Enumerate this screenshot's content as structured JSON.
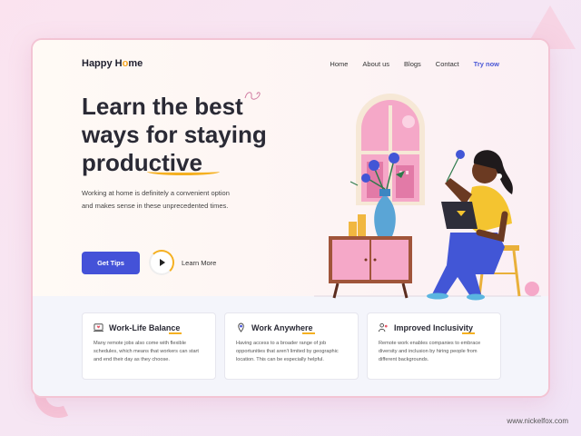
{
  "brand": {
    "logo_left": "Happy H",
    "logo_o": "o",
    "logo_right": "me"
  },
  "nav": {
    "home": "Home",
    "about": "About us",
    "blogs": "Blogs",
    "contact": "Contact",
    "try": "Try now"
  },
  "hero": {
    "line1": "Learn the best",
    "line2": "ways for staying",
    "line3": "productive",
    "description": "Working at home is definitely a convenient option and makes sense in these unprecedented times.",
    "cta_primary": "Get Tips",
    "cta_secondary": "Learn More"
  },
  "features": [
    {
      "title": "Work-Life Balance",
      "text": "Many remote jobs also come with flexible schedules, which means that workers can start and end their day as they choose.",
      "icon": "laptop-heart-icon"
    },
    {
      "title": "Work Anywhere",
      "text": "Having access to a broader range of job opportunities that aren't limited by geographic location. This can be especially helpful.",
      "icon": "location-pin-icon"
    },
    {
      "title": "Improved Inclusivity",
      "text": "Remote work enables companies to embrace diversity and inclusion by hiring people from different backgrounds.",
      "icon": "people-icon"
    }
  ],
  "footer": {
    "website": "www.nickelfox.com"
  },
  "colors": {
    "accent": "#4452d8",
    "highlight": "#f5b021",
    "pink": "#f5a8c8"
  }
}
